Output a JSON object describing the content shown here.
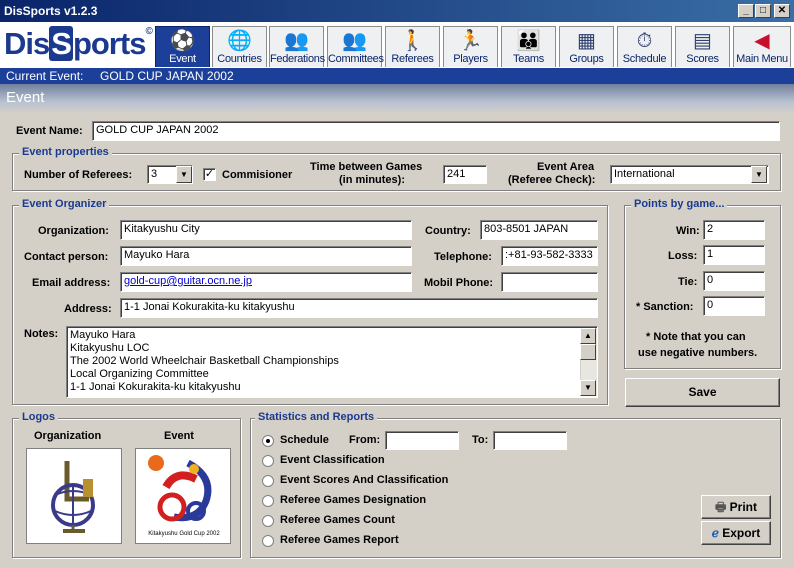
{
  "window": {
    "title": "DisSports  v1.2.3",
    "minimize": "_",
    "maximize": "□",
    "close": "✕"
  },
  "logo": {
    "part1": "Dis",
    "part2": "S",
    "part3": "ports",
    "mark": "©"
  },
  "toolbar": [
    {
      "label": "Event",
      "icon": "event-icon",
      "glyph": "⚽"
    },
    {
      "label": "Countries",
      "icon": "globe-icon",
      "glyph": "🌐"
    },
    {
      "label": "Federations",
      "icon": "federations-icon",
      "glyph": "👥"
    },
    {
      "label": "Committees",
      "icon": "committees-icon",
      "glyph": "👥"
    },
    {
      "label": "Referees",
      "icon": "referee-icon",
      "glyph": "🚶"
    },
    {
      "label": "Players",
      "icon": "player-icon",
      "glyph": "🏃"
    },
    {
      "label": "Teams",
      "icon": "teams-icon",
      "glyph": "👪"
    },
    {
      "label": "Groups",
      "icon": "groups-icon",
      "glyph": "▦"
    },
    {
      "label": "Schedule",
      "icon": "stopwatch-icon",
      "glyph": "⏱"
    },
    {
      "label": "Scores",
      "icon": "scoreboard-icon",
      "glyph": "▤"
    },
    {
      "label": "Main Menu",
      "icon": "exit-icon",
      "glyph": "◀"
    }
  ],
  "current_event": {
    "label": "Current Event:",
    "value": "GOLD CUP JAPAN 2002"
  },
  "section_title": "Event",
  "event_name": {
    "label": "Event Name:",
    "value": "GOLD CUP JAPAN 2002"
  },
  "properties": {
    "title": "Event properties",
    "referees_label": "Number of Referees:",
    "referees_value": "3",
    "commissioner_label": "Commisioner",
    "commissioner_checked": "✓",
    "time_label_1": "Time between Games",
    "time_label_2": "(in minutes):",
    "time_value": "241",
    "area_label_1": "Event Area",
    "area_label_2": "(Referee Check):",
    "area_value": "International"
  },
  "organizer": {
    "title": "Event Organizer",
    "organization_label": "Organization:",
    "organization_value": "Kitakyushu City",
    "country_label": "Country:",
    "country_value": "803-8501 JAPAN",
    "contact_label": "Contact person:",
    "contact_value": "Mayuko Hara",
    "telephone_label": "Telephone:",
    "telephone_value": ":+81-93-582-3333",
    "email_label": "Email address:",
    "email_value": "gold-cup@guitar.ocn.ne.jp",
    "mobil_label": "Mobil Phone:",
    "mobil_value": "",
    "address_label": "Address:",
    "address_value": "1-1 Jonai Kokurakita-ku kitakyushu",
    "notes_label": "Notes:",
    "notes_lines": [
      "Mayuko Hara",
      "Kitakyushu LOC",
      "The 2002 World Wheelchair Basketball Championships",
      "Local Organizing Committee",
      "1-1 Jonai Kokurakita-ku kitakyushu"
    ]
  },
  "points": {
    "title": "Points by game...",
    "win_label": "Win:",
    "win_value": "2",
    "loss_label": "Loss:",
    "loss_value": "1",
    "tie_label": "Tie:",
    "tie_value": "0",
    "sanction_label": "* Sanction:",
    "sanction_value": "0",
    "note_1": "* Note that you can",
    "note_2": "use negative numbers."
  },
  "save_label": "Save",
  "logos": {
    "title": "Logos",
    "organization_label": "Organization",
    "event_label": "Event",
    "event_caption": "Kitakyushu Gold Cup 2002"
  },
  "reports": {
    "title": "Statistics and Reports",
    "options": [
      "Schedule",
      "Event Classification",
      "Event Scores And Classification",
      "Referee Games Designation",
      "Referee Games Count",
      "Referee Games Report"
    ],
    "selected": "Schedule",
    "from_label": "From:",
    "to_label": "To:",
    "from_value": "",
    "to_value": "",
    "print_label": "Print",
    "export_label": "Export"
  },
  "colors": {
    "title_bar": "#0a246a",
    "accent": "#1c3f9a",
    "group_title": "#1b3a8f"
  }
}
